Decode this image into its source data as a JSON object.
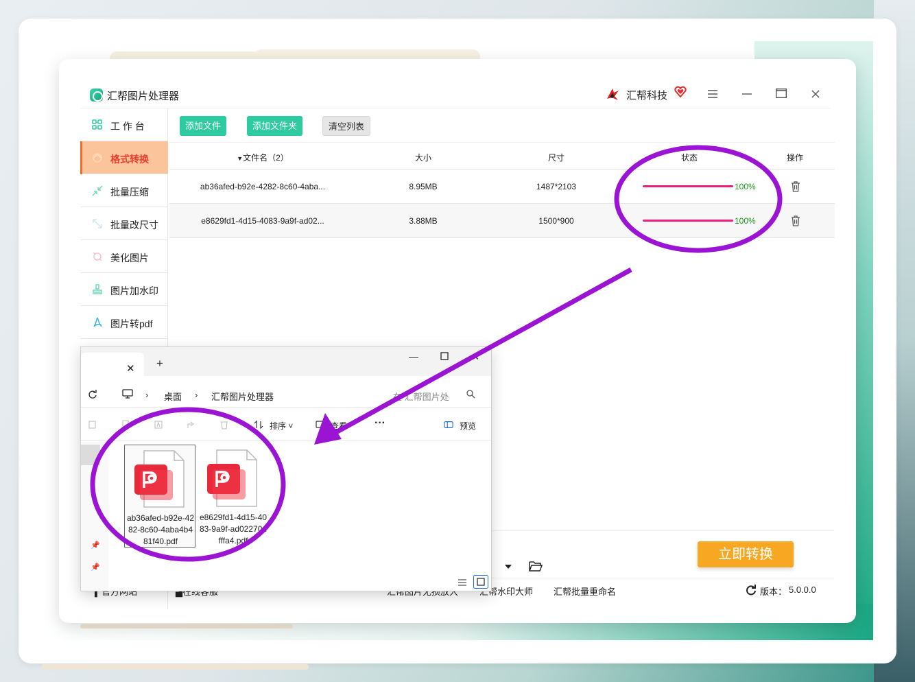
{
  "app": {
    "title": "汇帮图片处理器",
    "brand": "汇帮科技",
    "accent_color": "#2ecba0",
    "active_color": "#fbc49a"
  },
  "sidebar": {
    "items": [
      {
        "label": "工 作 台",
        "icon": "grid-icon",
        "active": false
      },
      {
        "label": "格式转换",
        "icon": "convert-icon",
        "active": true
      },
      {
        "label": "批量压缩",
        "icon": "compress-icon",
        "active": false
      },
      {
        "label": "批量改尺寸",
        "icon": "resize-icon",
        "active": false
      },
      {
        "label": "美化图片",
        "icon": "beautify-icon",
        "active": false
      },
      {
        "label": "图片加水印",
        "icon": "watermark-icon",
        "active": false
      },
      {
        "label": "图片转pdf",
        "icon": "pdf-icon",
        "active": false
      }
    ]
  },
  "toolbar": {
    "add_file": "添加文件",
    "add_folder": "添加文件夹",
    "clear_list": "清空列表"
  },
  "table": {
    "headers": {
      "filename": "文件名（2）",
      "size": "大小",
      "dimensions": "尺寸",
      "status": "状态",
      "actions": "操作"
    },
    "rows": [
      {
        "name": "ab36afed-b92e-4282-8c60-4aba...",
        "size": "8.95MB",
        "dims": "1487*2103",
        "progress": 1.0,
        "progress_label": "100%"
      },
      {
        "name": "e8629fd1-4d15-4083-9a9f-ad02...",
        "size": "3.88MB",
        "dims": "1500*900",
        "progress": 1.0,
        "progress_label": "100%"
      }
    ],
    "progress_color": "#e81f79"
  },
  "footer": {
    "convert_button": "立即转换",
    "links": [
      "官方网站",
      "在线客服",
      "汇帮图片无损放大",
      "汇帮水印大师",
      "汇帮批量重命名"
    ],
    "version_label": "版本：",
    "version": "5.0.0.0"
  },
  "explorer": {
    "breadcrumb": [
      "桌面",
      "汇帮图片处理器"
    ],
    "search_placeholder": "在 汇帮图片处",
    "commands": {
      "sort": "排序",
      "view": "查看",
      "more": "···",
      "preview": "预览"
    },
    "files": [
      {
        "name": "ab36afed-b92e-4282-8c60-4aba4b481f40.pdf",
        "icon": "pdf-file-icon",
        "selected": true
      },
      {
        "name": "e8629fd1-4d15-4083-9a9f-ad02270dfffa4.pdf",
        "icon": "pdf-file-icon",
        "selected": false
      }
    ]
  },
  "annotation": {
    "color": "#9b14d3"
  }
}
